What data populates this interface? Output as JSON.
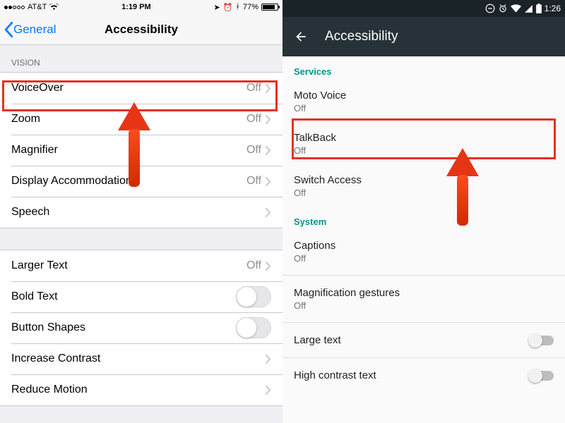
{
  "ios": {
    "status": {
      "carrier": "AT&T",
      "time": "1:19 PM",
      "battery": "77%"
    },
    "nav": {
      "back": "General",
      "title": "Accessibility"
    },
    "section_vision": "VISION",
    "rows1": [
      {
        "label": "VoiceOver",
        "value": "Off"
      },
      {
        "label": "Zoom",
        "value": "Off"
      },
      {
        "label": "Magnifier",
        "value": "Off"
      },
      {
        "label": "Display Accommodations",
        "value": "Off"
      },
      {
        "label": "Speech",
        "value": ""
      }
    ],
    "rows2": [
      {
        "label": "Larger Text",
        "value": "Off",
        "type": "disclosure"
      },
      {
        "label": "Bold Text",
        "type": "switch"
      },
      {
        "label": "Button Shapes",
        "type": "switch"
      },
      {
        "label": "Increase Contrast",
        "type": "disclosure"
      },
      {
        "label": "Reduce Motion",
        "type": "disclosure"
      }
    ]
  },
  "android": {
    "status": {
      "time": "1:26"
    },
    "appbar": {
      "title": "Accessibility"
    },
    "sections": {
      "services": {
        "header": "Services",
        "items": [
          {
            "primary": "Moto Voice",
            "secondary": "Off"
          },
          {
            "primary": "TalkBack",
            "secondary": "Off"
          },
          {
            "primary": "Switch Access",
            "secondary": "Off"
          }
        ]
      },
      "system": {
        "header": "System",
        "items": [
          {
            "primary": "Captions",
            "secondary": "Off"
          },
          {
            "primary": "Magnification gestures",
            "secondary": "Off"
          },
          {
            "primary": "Large text",
            "type": "switch"
          },
          {
            "primary": "High contrast text",
            "type": "switch"
          }
        ]
      }
    }
  }
}
